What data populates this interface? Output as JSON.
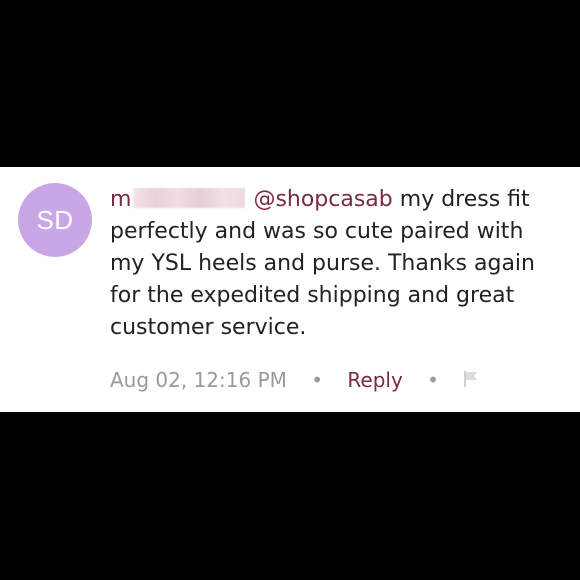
{
  "comment": {
    "avatar_initials": "SD",
    "username_visible": "m",
    "mention": "@shopcasab",
    "text": " my dress fit perfectly and was so cute paired with my YSL heels and purse. Thanks again for the expedited shipping and great customer service.",
    "timestamp": "Aug 02, 12:16 PM",
    "separator": "•",
    "reply_label": "Reply"
  },
  "colors": {
    "avatar_bg": "#c9a6e6",
    "accent": "#7a2a44",
    "meta_text": "#9a9a9a",
    "background": "#000000"
  },
  "icons": {
    "flag": "flag-icon"
  }
}
